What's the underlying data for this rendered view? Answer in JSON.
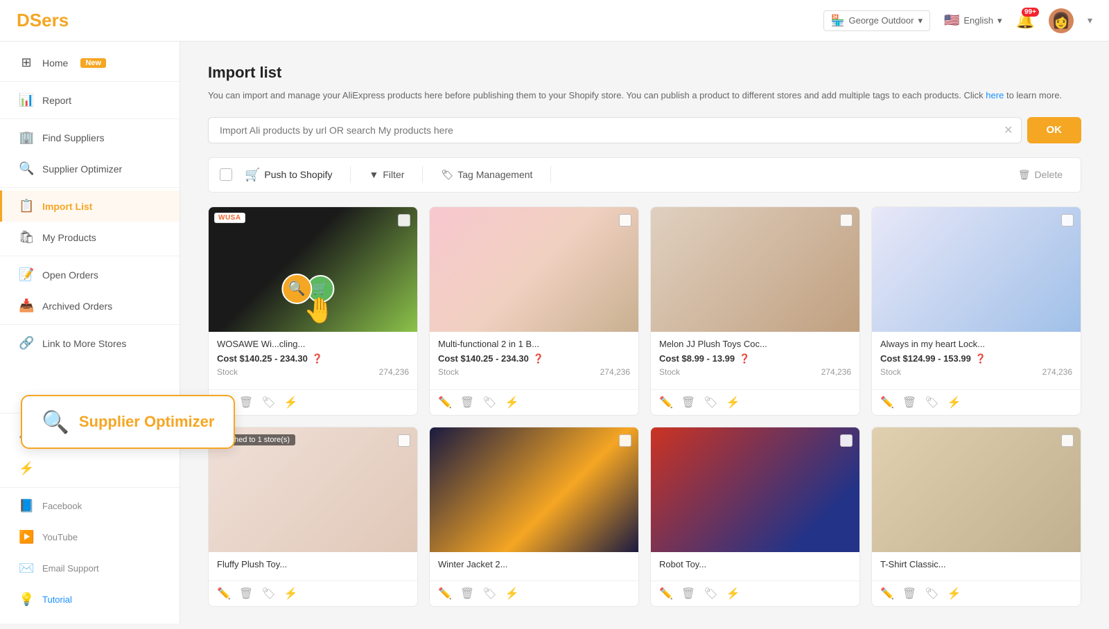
{
  "app": {
    "name": "DSers"
  },
  "header": {
    "store": "George Outdoor",
    "language": "English",
    "notif_badge": "99+",
    "store_icon": "🏪"
  },
  "sidebar": {
    "items": [
      {
        "id": "home",
        "label": "Home",
        "icon": "⊞",
        "badge": "New",
        "active": false
      },
      {
        "id": "report",
        "label": "Report",
        "icon": "📊",
        "active": false
      },
      {
        "id": "find-suppliers",
        "label": "Find Suppliers",
        "icon": "🏢",
        "active": false
      },
      {
        "id": "supplier-optimizer",
        "label": "Supplier Optimizer",
        "icon": "🔍",
        "active": false
      },
      {
        "id": "import-list",
        "label": "Import List",
        "icon": "📋",
        "active": true
      },
      {
        "id": "my-products",
        "label": "My Products",
        "icon": "🛍",
        "active": false
      },
      {
        "id": "open-orders",
        "label": "Open Orders",
        "icon": "📝",
        "active": false
      },
      {
        "id": "archived-orders",
        "label": "Archived Orders",
        "icon": "📥",
        "active": false
      },
      {
        "id": "link-to-more-stores",
        "label": "Link to More Stores",
        "icon": "🔗",
        "active": false
      }
    ],
    "bottom_items": [
      {
        "id": "settings",
        "label": "",
        "icon": "⚙️"
      },
      {
        "id": "filters",
        "label": "",
        "icon": "⚡"
      },
      {
        "id": "facebook",
        "label": "Facebook",
        "icon": "📘"
      },
      {
        "id": "youtube",
        "label": "YouTube",
        "icon": "▶️"
      },
      {
        "id": "email-support",
        "label": "Email Support",
        "icon": "✉️"
      },
      {
        "id": "tutorial",
        "label": "Tutorial",
        "icon": "💡"
      }
    ]
  },
  "page": {
    "title": "Import list",
    "description": "You can import and manage your AliExpress products here before publishing them to your Shopify store. You can publish a product to different stores and add multiple tags to each products. Click",
    "link_text": "here",
    "description_end": "to learn more."
  },
  "search": {
    "placeholder": "Import Ali products by url OR search My products here"
  },
  "toolbar": {
    "push_label": "Push to Shopify",
    "filter_label": "Filter",
    "tag_management_label": "Tag Management",
    "delete_label": "Delete"
  },
  "products": [
    {
      "id": 1,
      "name": "WOSAWE Wi...cling...",
      "cost": "Cost $140.25 - 234.30",
      "stock_label": "Stock",
      "stock_value": "274,236",
      "img_class": "img-jacket",
      "has_wusa": true,
      "has_optimizer": true,
      "pushed": false
    },
    {
      "id": 2,
      "name": "Multi-functional 2 in 1 B...",
      "cost": "Cost $140.25 - 234.30",
      "stock_label": "Stock",
      "stock_value": "274,236",
      "img_class": "img-stroller",
      "has_wusa": false,
      "has_optimizer": false,
      "pushed": false
    },
    {
      "id": 3,
      "name": "Melon JJ Plush Toys Coc...",
      "cost": "Cost $8.99 - 13.99",
      "stock_label": "Stock",
      "stock_value": "274,236",
      "img_class": "img-dress",
      "has_wusa": false,
      "has_optimizer": false,
      "pushed": false
    },
    {
      "id": 4,
      "name": "Always in my heart Lock...",
      "cost": "Cost $124.99 - 153.99",
      "stock_label": "Stock",
      "stock_value": "274,236",
      "img_class": "img-pendant",
      "has_wusa": false,
      "has_optimizer": false,
      "pushed": false
    },
    {
      "id": 5,
      "name": "Fluffy Plush Toy...",
      "cost": "",
      "stock_label": "",
      "stock_value": "",
      "img_class": "img-fluffy",
      "has_wusa": false,
      "has_optimizer": false,
      "pushed": true,
      "pushed_label": "Pushed to 1 store(s)"
    },
    {
      "id": 6,
      "name": "Winter Jacket 2...",
      "cost": "",
      "stock_label": "",
      "stock_value": "",
      "img_class": "img-jacket2",
      "has_wusa": false,
      "has_optimizer": false,
      "pushed": false
    },
    {
      "id": 7,
      "name": "Robot Toy...",
      "cost": "",
      "stock_label": "",
      "stock_value": "",
      "img_class": "img-robot",
      "has_wusa": false,
      "has_optimizer": false,
      "pushed": false
    },
    {
      "id": 8,
      "name": "T-Shirt Classic...",
      "cost": "",
      "stock_label": "",
      "stock_value": "",
      "img_class": "img-tshirt",
      "has_wusa": false,
      "has_optimizer": false,
      "pushed": false
    }
  ],
  "supplier_optimizer_tooltip": {
    "label": "Supplier Optimizer"
  }
}
